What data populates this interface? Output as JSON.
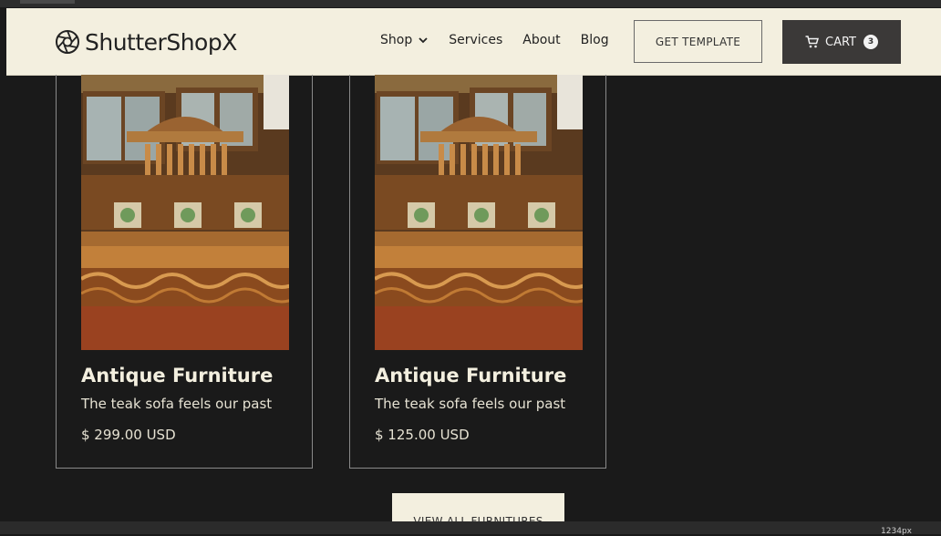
{
  "header": {
    "logo_text": "ShutterShopX",
    "nav": [
      {
        "label": "Shop",
        "has_dropdown": true
      },
      {
        "label": "Services",
        "has_dropdown": false
      },
      {
        "label": "About",
        "has_dropdown": false
      },
      {
        "label": "Blog",
        "has_dropdown": false
      }
    ],
    "get_template_label": "GET TEMPLATE",
    "cart_label": "CART",
    "cart_count": "3"
  },
  "products": [
    {
      "title": "Antique Furniture",
      "description": "The teak sofa feels our past",
      "price": "$ 299.00 USD"
    },
    {
      "title": "Antique Furniture",
      "description": "The teak sofa feels our past",
      "price": "$ 125.00 USD"
    }
  ],
  "view_all_label": "VIEW ALL FURNITURES",
  "status": {
    "zoom": "1234px"
  },
  "colors": {
    "page_bg": "#1a1a1a",
    "header_bg": "#f3efdf",
    "cart_bg": "#3b3938",
    "card_text": "#f3efdf"
  },
  "icons": [
    "aperture-icon",
    "chevron-down-icon",
    "cart-icon"
  ]
}
